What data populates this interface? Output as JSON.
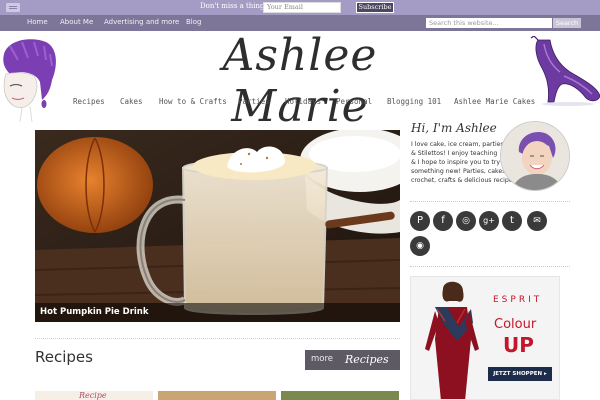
{
  "topbar": {
    "newsletter_prompt": "Don't miss a thing!",
    "email_placeholder": "Your Email",
    "subscribe_label": "Subscribe"
  },
  "top_nav": {
    "items": [
      {
        "label": "Home"
      },
      {
        "label": "About Me"
      },
      {
        "label": "Advertising and more"
      },
      {
        "label": "Blog"
      }
    ],
    "search_placeholder": "Search this website...",
    "search_label": "Search"
  },
  "header": {
    "site_title": "Ashlee Marie"
  },
  "main_nav": {
    "items": [
      {
        "label": "Recipes"
      },
      {
        "label": "Cakes"
      },
      {
        "label": "How to & Crafts"
      },
      {
        "label": "Parties"
      },
      {
        "label": "Holidays"
      },
      {
        "label": "Personal"
      },
      {
        "label": "Blogging 101"
      },
      {
        "label": "Ashlee Marie Cakes"
      }
    ]
  },
  "hero": {
    "caption": "Hot Pumpkin Pie Drink"
  },
  "recipes_section": {
    "title": "Recipes",
    "more_label": "more",
    "more_script": "Recipes",
    "thumb_labels": [
      "Recipe"
    ]
  },
  "sidebar": {
    "greeting": "Hi, I'm Ashlee",
    "bio_lines": [
      "I love cake, ice cream, parties",
      "& Stilettos! I enjoy teaching",
      "& I hope to inspire you to try",
      "something new! Parties, cakes",
      "crochet, crafts & delicious recipes!"
    ],
    "social": [
      {
        "icon": "pinterest-icon",
        "glyph": "P"
      },
      {
        "icon": "facebook-icon",
        "glyph": "f"
      },
      {
        "icon": "instagram-icon",
        "glyph": "◎"
      },
      {
        "icon": "google-plus-icon",
        "glyph": "g+"
      },
      {
        "icon": "twitter-icon",
        "glyph": "t"
      },
      {
        "icon": "email-icon",
        "glyph": "✉"
      },
      {
        "icon": "rss-icon",
        "glyph": "◉"
      }
    ]
  },
  "ad": {
    "brand": "ESPRIT",
    "line1": "Colour",
    "line2": "UP",
    "cta": "JETZT SHOPPEN ▸"
  },
  "colors": {
    "topbar": "#a59cc6",
    "navbar": "#7d7698",
    "accent_purple": "#7b4fb0"
  }
}
